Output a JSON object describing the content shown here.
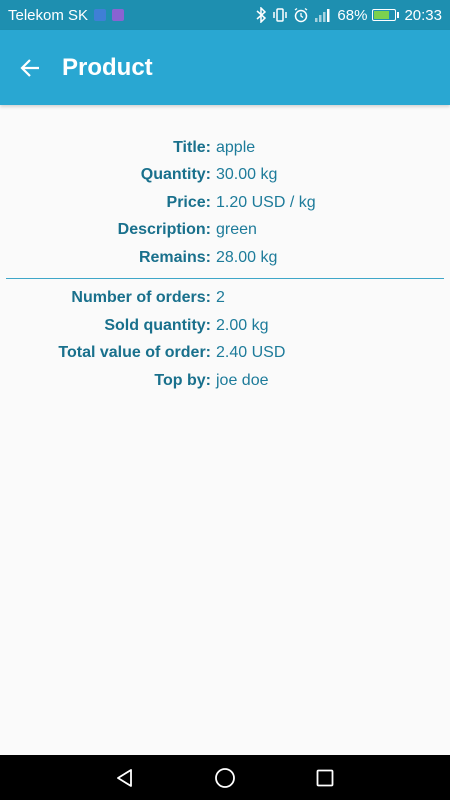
{
  "status_bar": {
    "carrier": "Telekom SK",
    "battery_percent": "68%",
    "battery_level": 0.68,
    "time": "20:33",
    "icons": [
      "video-icon",
      "gallery-icon",
      "bluetooth-icon",
      "vibrate-icon",
      "alarm-icon",
      "signal-icon",
      "battery-charging-icon"
    ]
  },
  "app_bar": {
    "title": "Product",
    "back_icon": "arrow-left-icon"
  },
  "product": {
    "title_label": "Title:",
    "title_value": "apple",
    "quantity_label": "Quantity:",
    "quantity_value": "30.00 kg",
    "price_label": "Price:",
    "price_value": "1.20 USD / kg",
    "description_label": "Description:",
    "description_value": "green",
    "remains_label": "Remains:",
    "remains_value": "28.00 kg"
  },
  "orders": {
    "count_label": "Number of orders:",
    "count_value": "2",
    "sold_label": "Sold quantity:",
    "sold_value": "2.00 kg",
    "total_label": "Total value of order:",
    "total_value": "2.40 USD",
    "top_label": "Top by:",
    "top_value": "joe doe"
  },
  "nav_bar": {
    "icons": [
      "back-triangle-icon",
      "home-circle-icon",
      "recents-square-icon"
    ]
  },
  "colors": {
    "status_bar": "#1e8fb0",
    "app_bar": "#29a7d2",
    "label": "#19708c",
    "value": "#1d7b9a",
    "divider": "#3fa6c8"
  }
}
